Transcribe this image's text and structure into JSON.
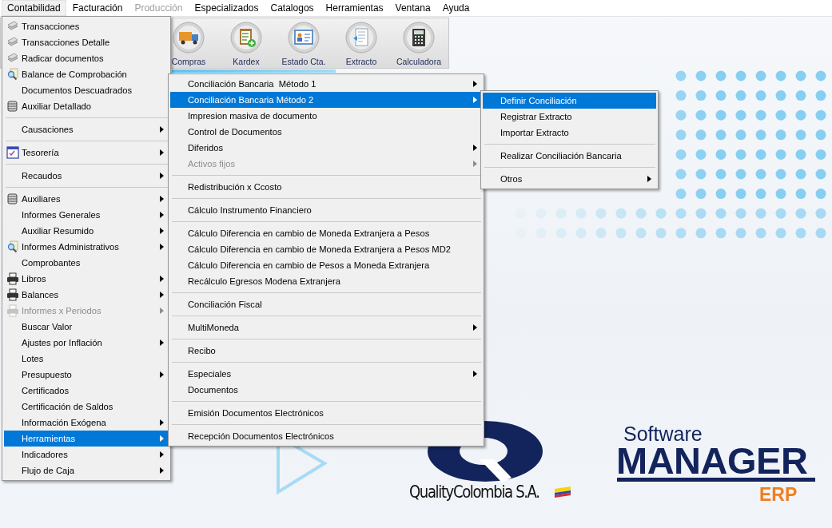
{
  "menubar": [
    {
      "label": "Contabilidad",
      "selected": true,
      "disabled": false
    },
    {
      "label": "Facturación",
      "selected": false,
      "disabled": false
    },
    {
      "label": "Producción",
      "selected": false,
      "disabled": true
    },
    {
      "label": "Especializados",
      "selected": false,
      "disabled": false
    },
    {
      "label": "Catalogos",
      "selected": false,
      "disabled": false
    },
    {
      "label": "Herramientas",
      "selected": false,
      "disabled": false
    },
    {
      "label": "Ventana",
      "selected": false,
      "disabled": false
    },
    {
      "label": "Ayuda",
      "selected": false,
      "disabled": false
    }
  ],
  "toolbar": [
    {
      "label": "Compras"
    },
    {
      "label": "Kardex"
    },
    {
      "label": "Estado Cta."
    },
    {
      "label": "Extracto"
    },
    {
      "label": "Calculadora"
    }
  ],
  "menus": [
    {
      "items": [
        {
          "kind": "item",
          "label": "Transacciones",
          "submenu": false,
          "selected": false,
          "disabled": false
        },
        {
          "kind": "item",
          "label": "Transacciones Detalle",
          "submenu": false,
          "selected": false,
          "disabled": false
        },
        {
          "kind": "item",
          "label": "Radicar documentos",
          "submenu": false,
          "selected": false,
          "disabled": false
        },
        {
          "kind": "item",
          "label": "Balance de Comprobación",
          "submenu": false,
          "selected": false,
          "disabled": false
        },
        {
          "kind": "item",
          "label": "Documentos Descuadrados",
          "submenu": false,
          "selected": false,
          "disabled": false
        },
        {
          "kind": "item",
          "label": "Auxiliar Detallado",
          "submenu": false,
          "selected": false,
          "disabled": false
        },
        {
          "kind": "separator"
        },
        {
          "kind": "item",
          "label": "Causaciones",
          "submenu": true,
          "selected": false,
          "disabled": false
        },
        {
          "kind": "separator"
        },
        {
          "kind": "item",
          "label": "Tesorería",
          "submenu": true,
          "selected": false,
          "disabled": false
        },
        {
          "kind": "separator"
        },
        {
          "kind": "item",
          "label": "Recaudos",
          "submenu": true,
          "selected": false,
          "disabled": false
        },
        {
          "kind": "separator"
        },
        {
          "kind": "item",
          "label": "Auxiliares",
          "submenu": true,
          "selected": false,
          "disabled": false
        },
        {
          "kind": "item",
          "label": "Informes Generales",
          "submenu": true,
          "selected": false,
          "disabled": false
        },
        {
          "kind": "item",
          "label": "Auxiliar Resumido",
          "submenu": true,
          "selected": false,
          "disabled": false
        },
        {
          "kind": "item",
          "label": "Informes Administrativos",
          "submenu": true,
          "selected": false,
          "disabled": false
        },
        {
          "kind": "item",
          "label": "Comprobantes",
          "submenu": false,
          "selected": false,
          "disabled": false
        },
        {
          "kind": "item",
          "label": "Libros",
          "submenu": true,
          "selected": false,
          "disabled": false
        },
        {
          "kind": "item",
          "label": "Balances",
          "submenu": true,
          "selected": false,
          "disabled": false
        },
        {
          "kind": "item",
          "label": "Informes x Periodos",
          "submenu": true,
          "selected": false,
          "disabled": true
        },
        {
          "kind": "item",
          "label": "Buscar Valor",
          "submenu": false,
          "selected": false,
          "disabled": false
        },
        {
          "kind": "item",
          "label": "Ajustes por Inflación",
          "submenu": true,
          "selected": false,
          "disabled": false
        },
        {
          "kind": "item",
          "label": "Lotes",
          "submenu": false,
          "selected": false,
          "disabled": false
        },
        {
          "kind": "item",
          "label": "Presupuesto",
          "submenu": true,
          "selected": false,
          "disabled": false
        },
        {
          "kind": "item",
          "label": "Certificados",
          "submenu": false,
          "selected": false,
          "disabled": false
        },
        {
          "kind": "item",
          "label": "Certificación de Saldos",
          "submenu": false,
          "selected": false,
          "disabled": false
        },
        {
          "kind": "item",
          "label": "Información Exógena",
          "submenu": true,
          "selected": false,
          "disabled": false
        },
        {
          "kind": "item",
          "label": "Herramientas",
          "submenu": true,
          "selected": true,
          "disabled": false
        },
        {
          "kind": "item",
          "label": "Indicadores",
          "submenu": true,
          "selected": false,
          "disabled": false
        },
        {
          "kind": "item",
          "label": "Flujo de Caja",
          "submenu": true,
          "selected": false,
          "disabled": false
        }
      ]
    },
    {
      "items": [
        {
          "kind": "item",
          "label": "Conciliación Bancaria  Método 1",
          "submenu": true,
          "selected": false,
          "disabled": false
        },
        {
          "kind": "item",
          "label": "Conciliación Bancaria Método 2",
          "submenu": true,
          "selected": true,
          "disabled": false
        },
        {
          "kind": "item",
          "label": "Impresion masiva de documento",
          "submenu": false,
          "selected": false,
          "disabled": false
        },
        {
          "kind": "item",
          "label": "Control de Documentos",
          "submenu": false,
          "selected": false,
          "disabled": false
        },
        {
          "kind": "item",
          "label": "Diferidos",
          "submenu": true,
          "selected": false,
          "disabled": false
        },
        {
          "kind": "item",
          "label": "Activos fijos",
          "submenu": true,
          "selected": false,
          "disabled": true
        },
        {
          "kind": "separator"
        },
        {
          "kind": "item",
          "label": "Redistribución x Ccosto",
          "submenu": false,
          "selected": false,
          "disabled": false
        },
        {
          "kind": "separator"
        },
        {
          "kind": "item",
          "label": "Cálculo Instrumento Financiero",
          "submenu": false,
          "selected": false,
          "disabled": false
        },
        {
          "kind": "separator"
        },
        {
          "kind": "item",
          "label": "Cálculo Diferencia en cambio de Moneda Extranjera a Pesos",
          "submenu": false,
          "selected": false,
          "disabled": false
        },
        {
          "kind": "item",
          "label": "Cálculo Diferencia en cambio de Moneda Extranjera a Pesos MD2",
          "submenu": false,
          "selected": false,
          "disabled": false
        },
        {
          "kind": "item",
          "label": "Cálculo Diferencia en cambio de Pesos a Moneda Extranjera",
          "submenu": false,
          "selected": false,
          "disabled": false
        },
        {
          "kind": "item",
          "label": "Recálculo Egresos Modena Extranjera",
          "submenu": false,
          "selected": false,
          "disabled": false
        },
        {
          "kind": "separator"
        },
        {
          "kind": "item",
          "label": "Conciliación Fiscal",
          "submenu": false,
          "selected": false,
          "disabled": false
        },
        {
          "kind": "separator"
        },
        {
          "kind": "item",
          "label": "MultiMoneda",
          "submenu": true,
          "selected": false,
          "disabled": false
        },
        {
          "kind": "separator"
        },
        {
          "kind": "item",
          "label": "Recibo",
          "submenu": false,
          "selected": false,
          "disabled": false
        },
        {
          "kind": "separator"
        },
        {
          "kind": "item",
          "label": "Especiales",
          "submenu": true,
          "selected": false,
          "disabled": false
        },
        {
          "kind": "item",
          "label": "Documentos",
          "submenu": false,
          "selected": false,
          "disabled": false
        },
        {
          "kind": "separator"
        },
        {
          "kind": "item",
          "label": "Emisión Documentos Electrónicos",
          "submenu": false,
          "selected": false,
          "disabled": false
        },
        {
          "kind": "separator"
        },
        {
          "kind": "item",
          "label": "Recepción Documentos Electrónicos",
          "submenu": false,
          "selected": false,
          "disabled": false
        }
      ]
    },
    {
      "items": [
        {
          "kind": "item",
          "label": "Definir Conciliación",
          "submenu": false,
          "selected": true,
          "disabled": false
        },
        {
          "kind": "item",
          "label": "Registrar Extracto",
          "submenu": false,
          "selected": false,
          "disabled": false
        },
        {
          "kind": "item",
          "label": "Importar Extracto",
          "submenu": false,
          "selected": false,
          "disabled": false
        },
        {
          "kind": "separator"
        },
        {
          "kind": "item",
          "label": "Realizar Conciliación Bancaria",
          "submenu": false,
          "selected": false,
          "disabled": false
        },
        {
          "kind": "separator"
        },
        {
          "kind": "item",
          "label": "Otros",
          "submenu": true,
          "selected": false,
          "disabled": false
        }
      ]
    }
  ],
  "logos": {
    "quality": "QualityColombia S.A.",
    "software": "Software",
    "manager": "MANAGER",
    "erp": "ERP"
  }
}
